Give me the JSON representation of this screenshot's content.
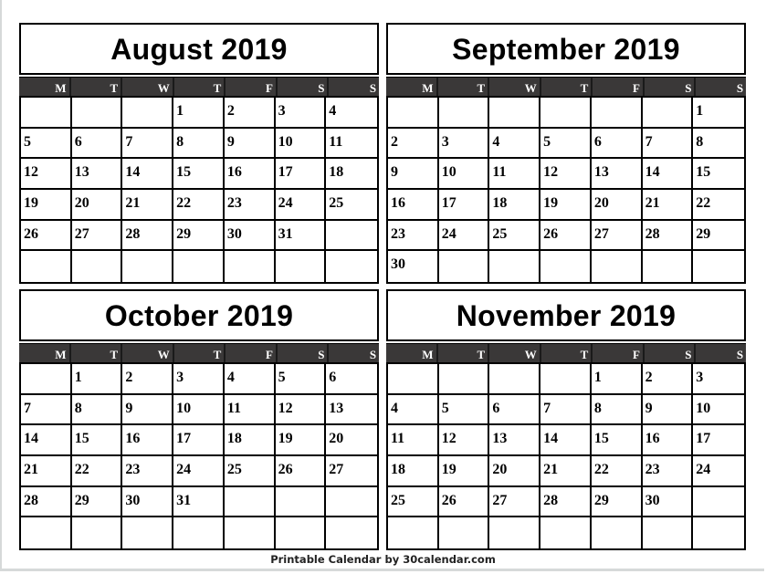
{
  "weekday_headers": [
    "M",
    "T",
    "W",
    "T",
    "F",
    "S",
    "S"
  ],
  "months": [
    {
      "title": "August 2019",
      "cells": [
        "",
        "",
        "",
        "1",
        "2",
        "3",
        "4",
        "5",
        "6",
        "7",
        "8",
        "9",
        "10",
        "11",
        "12",
        "13",
        "14",
        "15",
        "16",
        "17",
        "18",
        "19",
        "20",
        "21",
        "22",
        "23",
        "24",
        "25",
        "26",
        "27",
        "28",
        "29",
        "30",
        "31",
        "",
        "",
        "",
        "",
        "",
        "",
        "",
        ""
      ]
    },
    {
      "title": "September 2019",
      "cells": [
        "",
        "",
        "",
        "",
        "",
        "",
        "1",
        "2",
        "3",
        "4",
        "5",
        "6",
        "7",
        "8",
        "9",
        "10",
        "11",
        "12",
        "13",
        "14",
        "15",
        "16",
        "17",
        "18",
        "19",
        "20",
        "21",
        "22",
        "23",
        "24",
        "25",
        "26",
        "27",
        "28",
        "29",
        "30",
        "",
        "",
        "",
        "",
        "",
        ""
      ]
    },
    {
      "title": "October 2019",
      "cells": [
        "",
        "1",
        "2",
        "3",
        "4",
        "5",
        "6",
        "7",
        "8",
        "9",
        "10",
        "11",
        "12",
        "13",
        "14",
        "15",
        "16",
        "17",
        "18",
        "19",
        "20",
        "21",
        "22",
        "23",
        "24",
        "25",
        "26",
        "27",
        "28",
        "29",
        "30",
        "31",
        "",
        "",
        "",
        "",
        "",
        "",
        "",
        "",
        "",
        ""
      ]
    },
    {
      "title": "November 2019",
      "cells": [
        "",
        "",
        "",
        "",
        "1",
        "2",
        "3",
        "4",
        "5",
        "6",
        "7",
        "8",
        "9",
        "10",
        "11",
        "12",
        "13",
        "14",
        "15",
        "16",
        "17",
        "18",
        "19",
        "20",
        "21",
        "22",
        "23",
        "24",
        "25",
        "26",
        "27",
        "28",
        "29",
        "30",
        "",
        "",
        "",
        "",
        "",
        "",
        "",
        ""
      ]
    }
  ],
  "footer": "Printable Calendar by 30calendar.com",
  "colors": {
    "header_bg": "#3a3838",
    "header_text": "#ffffff",
    "grid_lines": "#000000"
  }
}
